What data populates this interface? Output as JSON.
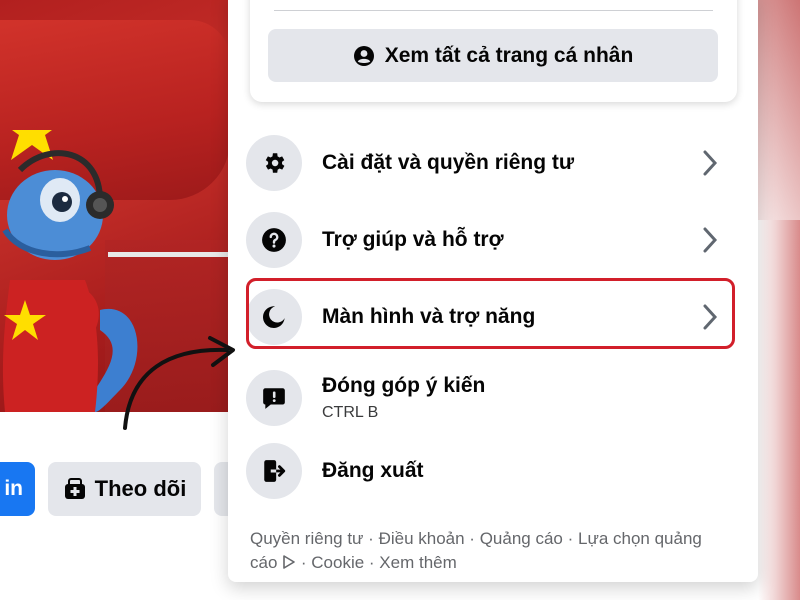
{
  "profile_card": {
    "see_all_label": "Xem tất cả trang cá nhân"
  },
  "menu_items": [
    {
      "label": "Cài đặt và quyền riêng tư",
      "icon": "gear-icon",
      "has_chevron": true
    },
    {
      "label": "Trợ giúp và hỗ trợ",
      "icon": "question-icon",
      "has_chevron": true
    },
    {
      "label": "Màn hình và trợ năng",
      "icon": "moon-icon",
      "has_chevron": true,
      "highlighted": true
    },
    {
      "label": "Đóng góp ý kiến",
      "sublabel": "CTRL B",
      "icon": "feedback-icon",
      "has_chevron": false
    },
    {
      "label": "Đăng xuất",
      "icon": "logout-icon",
      "has_chevron": false
    }
  ],
  "footer": {
    "links": [
      "Quyền riêng tư",
      "Điều khoản",
      "Quảng cáo",
      "Lựa chọn quảng cáo",
      "Cookie",
      "Xem thêm"
    ],
    "separator": " · "
  },
  "page_buttons": {
    "primary_label": "in",
    "follow_label": "Theo dõi"
  },
  "colors": {
    "highlight": "#d21f2a",
    "icon_bg": "#e4e6eb",
    "primary": "#1877f2",
    "cover_red": "#c8302a",
    "star_yellow": "#ffde00"
  }
}
